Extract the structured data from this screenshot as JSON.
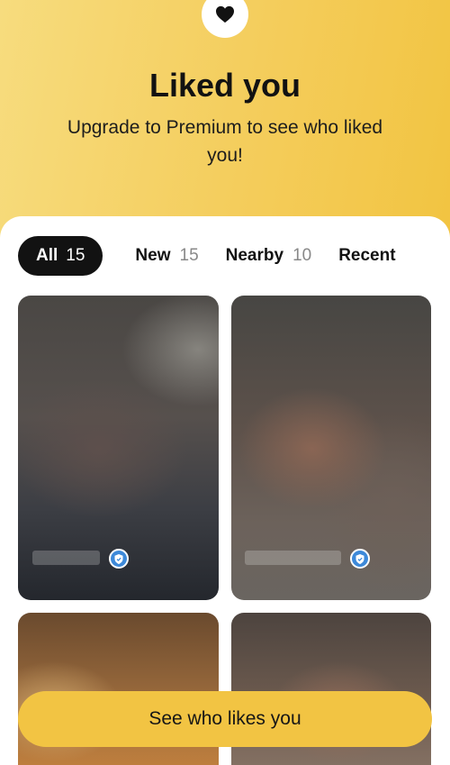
{
  "header": {
    "badge_icon": "heart-icon",
    "title": "Liked you",
    "subtitle": "Upgrade to Premium to see who liked you!"
  },
  "filters": [
    {
      "label": "All",
      "count": "15",
      "active": true
    },
    {
      "label": "New",
      "count": "15",
      "active": false
    },
    {
      "label": "Nearby",
      "count": "10",
      "active": false
    },
    {
      "label": "Recent",
      "count": "",
      "active": false
    }
  ],
  "profiles": [
    {
      "blurred": true,
      "verified": true
    },
    {
      "blurred": true,
      "verified": true
    },
    {
      "blurred": true,
      "verified": false
    },
    {
      "blurred": true,
      "verified": false
    }
  ],
  "cta": {
    "label": "See who likes you"
  },
  "colors": {
    "accent": "#f2c443",
    "verified": "#3d89d9",
    "chip_active": "#121212"
  }
}
